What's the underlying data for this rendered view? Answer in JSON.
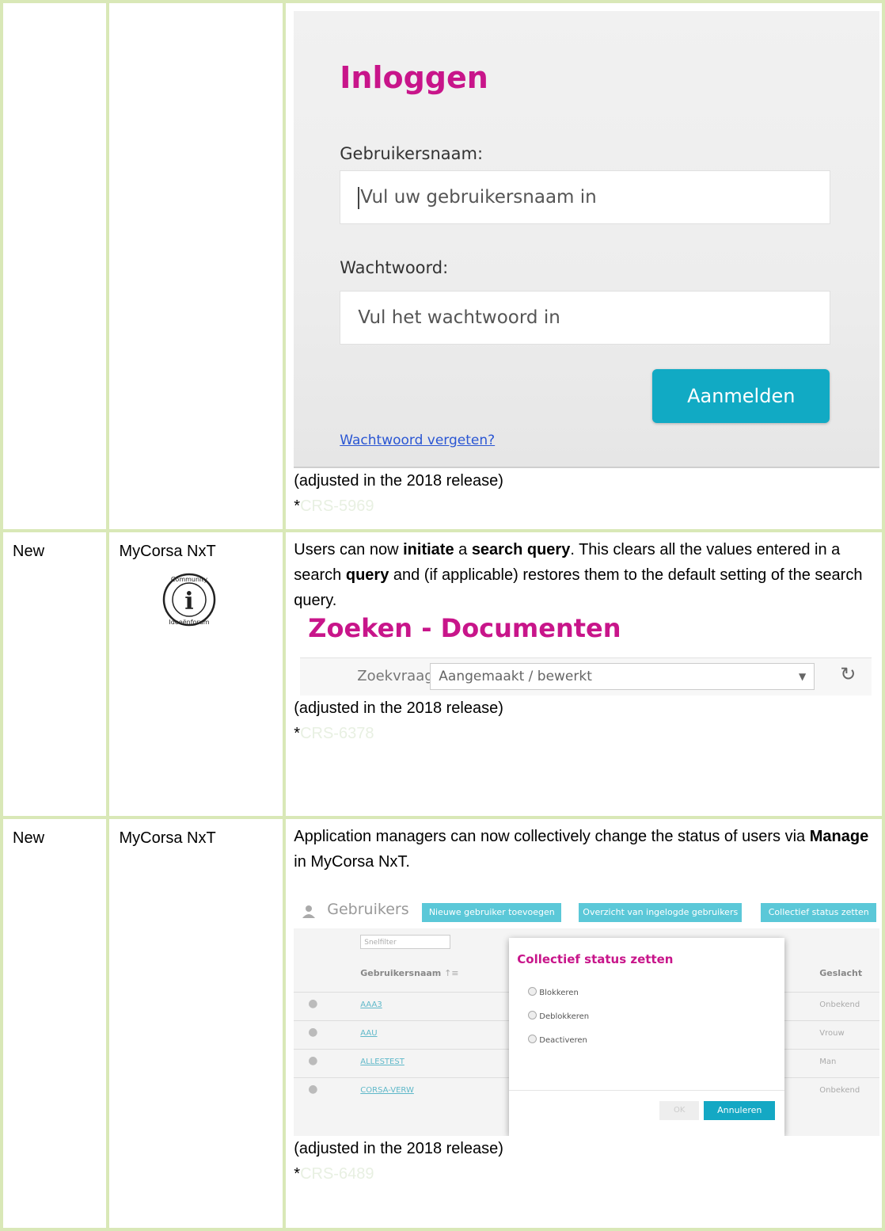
{
  "rows": [
    {
      "type": "",
      "module": "",
      "screenshot": {
        "title": "Inloggen",
        "username_label": "Gebruikersnaam:",
        "username_placeholder": "Vul uw gebruikersnaam in",
        "password_label": "Wachtwoord:",
        "password_placeholder": "Vul het wachtwoord in",
        "login_button": "Aanmelden",
        "forgot_link": "Wachtwoord vergeten?"
      },
      "adjusted": "(adjusted in the 2018 release)",
      "ref_prefix": "*",
      "ref": "CRS-5969"
    },
    {
      "type": "New",
      "module": "MyCorsa NxT",
      "badge_top": "Community",
      "badge_letter": "i",
      "badge_bottom": "Ideeënforum",
      "desc": {
        "p1": "Users can now ",
        "b1": "initiate",
        "p2": " a ",
        "b2": "search query",
        "p3": ". This clears all the values entered in a search ",
        "b3": "query",
        "p4": " and (if applicable) restores them to the default setting of the search query."
      },
      "screenshot": {
        "title": "Zoeken - Documenten",
        "query_label": "Zoekvraag:",
        "query_value": "Aangemaakt / bewerkt",
        "dropdown_icon": "▼",
        "refresh_icon": "↻"
      },
      "adjusted": "(adjusted in the 2018 release)",
      "ref_prefix": "*",
      "ref": "CRS-6378"
    },
    {
      "type": "New",
      "module": "MyCorsa NxT",
      "desc": {
        "p1": "Application managers can now collectively change the status of users via ",
        "b1": "Manage",
        "p2": " in MyCorsa NxT."
      },
      "screenshot": {
        "title": "Gebruikers",
        "btn_new": "Nieuwe gebruiker toevoegen",
        "btn_overview": "Overzicht van ingelogde gebruikers",
        "btn_collective": "Collectief status zetten",
        "filter_placeholder": "Snelfilter",
        "col_name": "Gebruikersnaam",
        "sort_icon": "↑≡",
        "col_gender": "Geslacht",
        "rows": [
          {
            "name": "AAA3",
            "gender": "Onbekend"
          },
          {
            "name": "AAU",
            "gender": "Vrouw"
          },
          {
            "name": "ALLESTEST",
            "gender": "Man"
          },
          {
            "name": "CORSA-VERW",
            "gender": "Onbekend"
          }
        ],
        "modal_title": "Collectief status zetten",
        "opt1": "Blokkeren",
        "opt2": "Deblokkeren",
        "opt3": "Deactiveren",
        "ok": "OK",
        "cancel": "Annuleren"
      },
      "adjusted": "(adjusted in the 2018 release)",
      "ref_prefix": "*",
      "ref": "CRS-6489"
    }
  ],
  "colors": {
    "border": "#d9e8b7",
    "magenta": "#c8158a",
    "button": "#11aac4",
    "ref_text": "#e8f0e2"
  }
}
